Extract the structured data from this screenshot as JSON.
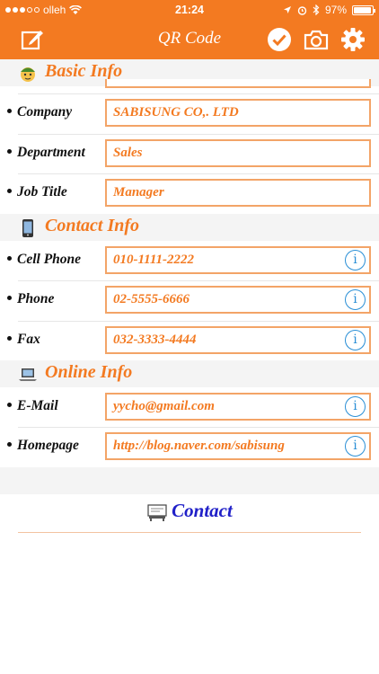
{
  "status_bar": {
    "carrier": "olleh",
    "time": "21:24",
    "battery_percent": "97%",
    "battery_level": 0.97,
    "signal_bars": 3
  },
  "nav": {
    "title": "QR Code",
    "icons": [
      "edit-icon",
      "checkmark-icon",
      "camera-icon",
      "gear-icon"
    ]
  },
  "sections": {
    "basic": {
      "title": "Basic Info",
      "icon": "person-emoji-icon"
    },
    "contact": {
      "title": "Contact Info",
      "icon": "phone-emoji-icon"
    },
    "online": {
      "title": "Online Info",
      "icon": "laptop-emoji-icon"
    }
  },
  "fields": {
    "company": {
      "label": "Company",
      "value": "SABISUNG CO,. LTD"
    },
    "department": {
      "label": "Department",
      "value": "Sales"
    },
    "job_title": {
      "label": "Job Title",
      "value": "Manager"
    },
    "cell_phone": {
      "label": "Cell Phone",
      "value": "010-1111-2222"
    },
    "phone": {
      "label": "Phone",
      "value": "02-5555-6666"
    },
    "fax": {
      "label": "Fax",
      "value": "032-3333-4444"
    },
    "email": {
      "label": "E-Mail",
      "value": "yycho@gmail.com"
    },
    "homepage": {
      "label": "Homepage",
      "value": "http://blog.naver.com/sabisung"
    }
  },
  "contact_button": {
    "label": "Contact",
    "icon": "business-card-icon"
  },
  "colors": {
    "accent": "#f37a21",
    "field_border": "#f3a467",
    "info_blue": "#2a8fd6",
    "contact_blue": "#2020c8"
  }
}
